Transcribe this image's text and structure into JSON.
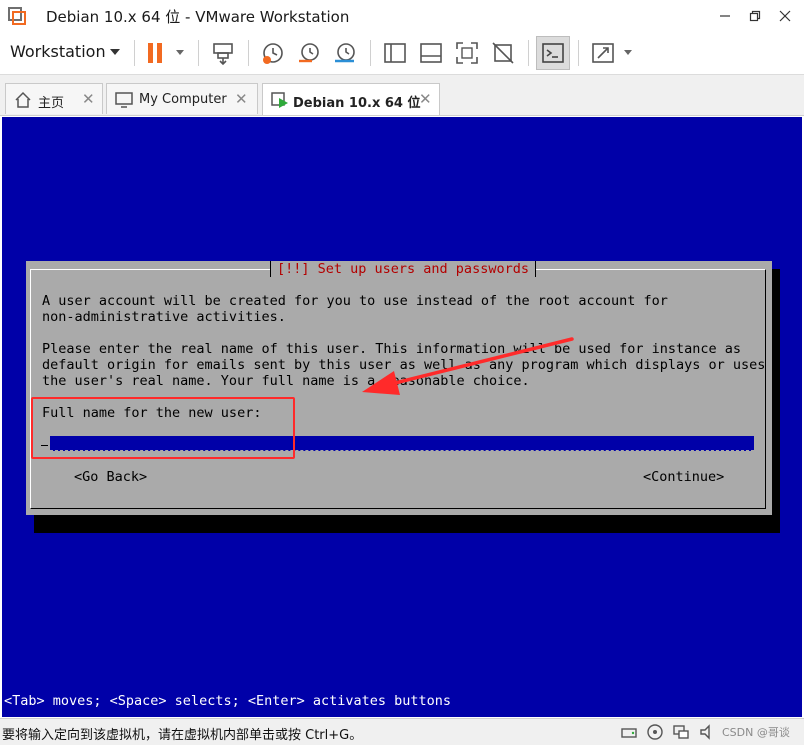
{
  "window": {
    "title": "Debian 10.x 64 位 - VMware Workstation"
  },
  "toolbar": {
    "workstation_label": "Workstation"
  },
  "tabs": [
    {
      "label": "主页",
      "icon": "home-icon",
      "active": false
    },
    {
      "label": "My Computer",
      "icon": "monitor-icon",
      "active": false
    },
    {
      "label": "Debian 10.x 64 位",
      "icon": "vm-running-icon",
      "active": true
    }
  ],
  "installer": {
    "dialog_title": "[!!] Set up users and passwords",
    "lines": [
      "A user account will be created for you to use instead of the root account for",
      "non-administrative activities.",
      "",
      "Please enter the real name of this user. This information will be used for instance as",
      "default origin for emails sent by this user as well as any program which displays or uses",
      "the user's real name. Your full name is a reasonable choice."
    ],
    "prompt": "Full name for the new user:",
    "input_value": "",
    "go_back": "<Go Back>",
    "continue": "<Continue>",
    "help": "<Tab> moves; <Space> selects; <Enter> activates buttons"
  },
  "colors": {
    "vm_background": "#0000a8",
    "dialog_background": "#aaaaaa",
    "title_red": "#b30000",
    "annotation_red": "#ff2a2a",
    "pause_orange": "#f26a21"
  },
  "statusbar": {
    "message": "要将输入定向到该虚拟机，请在虚拟机内部单击或按 Ctrl+G。",
    "watermark": "CSDN @哥谈"
  }
}
